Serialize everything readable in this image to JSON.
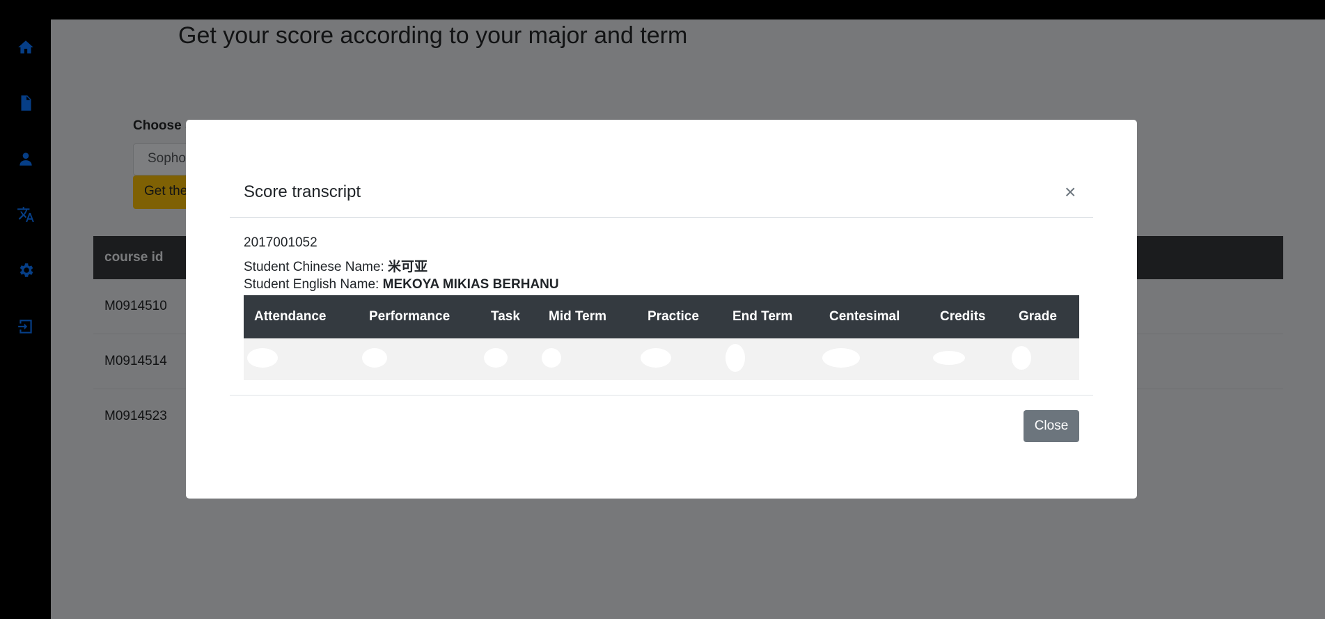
{
  "sidebar": {
    "items": [
      {
        "icon": "home-icon"
      },
      {
        "icon": "document-icon"
      },
      {
        "icon": "user-icon"
      },
      {
        "icon": "translate-icon"
      },
      {
        "icon": "gear-icon"
      },
      {
        "icon": "sign-in-icon"
      }
    ]
  },
  "main": {
    "title": "Get your score according to your major and term",
    "choose_label": "Choose S",
    "select_value": "Sopho",
    "get_button": "Get the",
    "table": {
      "header": "course id",
      "rows": [
        "M0914510",
        "M0914514",
        "M0914523"
      ]
    }
  },
  "modal": {
    "title": "Score transcript",
    "close_x": "×",
    "student_id": "2017001052",
    "chinese_name_label": "Student Chinese Name: ",
    "chinese_name": "米可亚",
    "english_name_label": "Student English Name: ",
    "english_name": "MEKOYA MIKIAS BERHANU",
    "columns": [
      "Attendance",
      "Performance",
      "Task",
      "Mid Term",
      "Practice",
      "End Term",
      "Centesimal",
      "Credits",
      "Grade"
    ],
    "close_button": "Close"
  },
  "colors": {
    "accent": "#0b57b0",
    "warning": "#ffc107",
    "secondary": "#6c757d",
    "dark": "#343a40"
  }
}
